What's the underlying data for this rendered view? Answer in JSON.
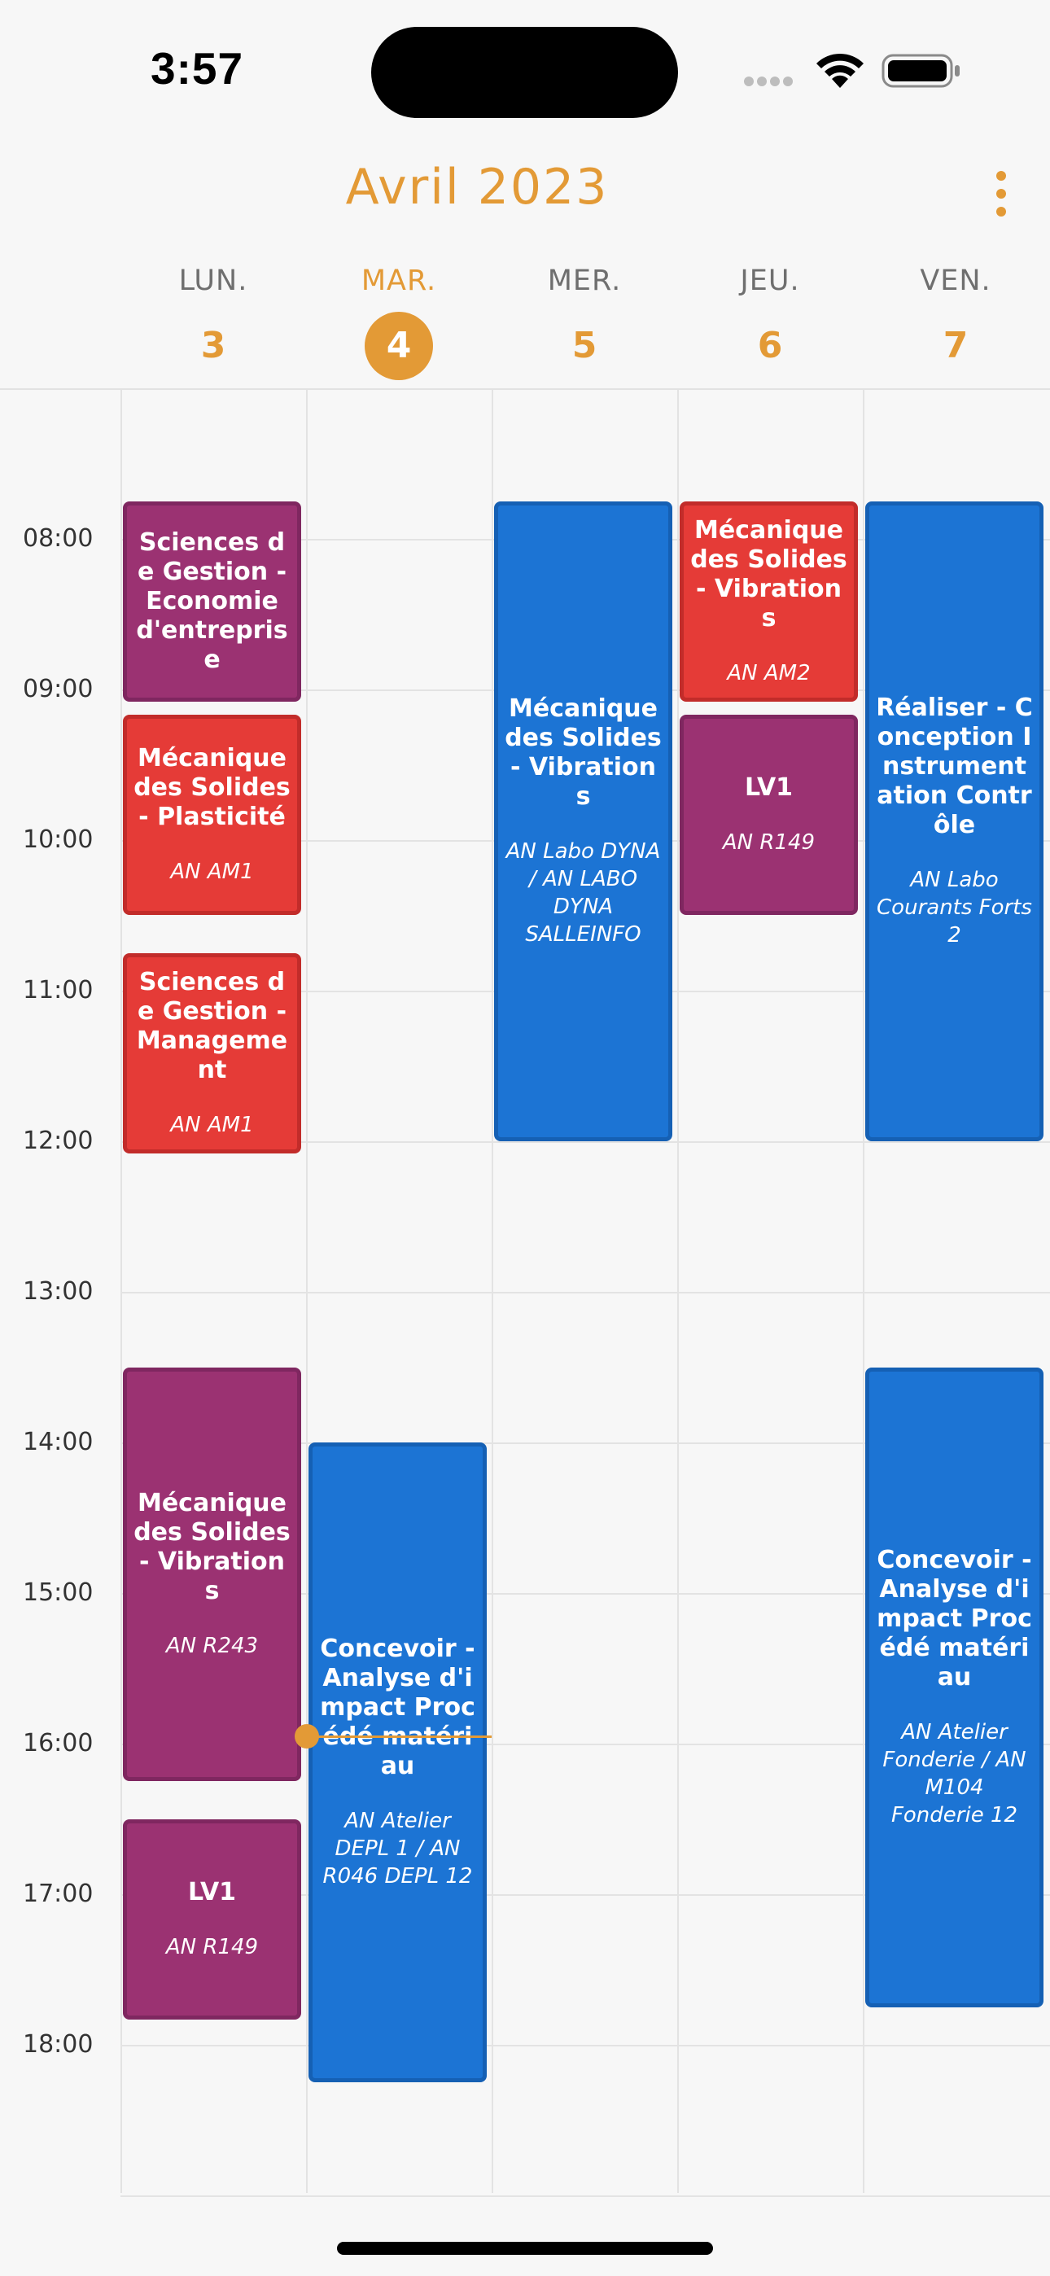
{
  "status_bar": {
    "time": "3:57"
  },
  "header": {
    "month": "Avril 2023",
    "days": [
      {
        "name": "LUN.",
        "number": "3",
        "today": false
      },
      {
        "name": "MAR.",
        "number": "4",
        "today": true
      },
      {
        "name": "MER.",
        "number": "5",
        "today": false
      },
      {
        "name": "JEU.",
        "number": "6",
        "today": false
      },
      {
        "name": "VEN.",
        "number": "7",
        "today": false
      }
    ]
  },
  "hours": [
    "08:00",
    "09:00",
    "10:00",
    "11:00",
    "12:00",
    "13:00",
    "14:00",
    "15:00",
    "16:00",
    "17:00",
    "18:00"
  ],
  "colors": {
    "accent": "#e39a36",
    "blue": "#1c74d4",
    "red": "#e53b37",
    "purple": "#9b3272"
  },
  "events": [
    {
      "day": 0,
      "start": "07:45",
      "end": "09:05",
      "color": "purple",
      "title": "Sciences de Gestion - Economie d'entreprise",
      "room": ""
    },
    {
      "day": 0,
      "start": "09:10",
      "end": "10:30",
      "color": "red",
      "title": "Mécanique des Solides - Plasticité",
      "room": "AN AM1"
    },
    {
      "day": 0,
      "start": "10:45",
      "end": "12:05",
      "color": "red",
      "title": "Sciences de Gestion - Management",
      "room": "AN AM1"
    },
    {
      "day": 0,
      "start": "13:30",
      "end": "16:15",
      "color": "purple",
      "title": "Mécanique des Solides - Vibrations",
      "room": "AN R243"
    },
    {
      "day": 0,
      "start": "16:30",
      "end": "17:50",
      "color": "purple",
      "title": "LV1",
      "room": "AN R149"
    },
    {
      "day": 1,
      "start": "14:00",
      "end": "18:15",
      "color": "blue",
      "title": "Concevoir - Analyse d'impact Procédé matériau",
      "room": "AN Atelier DEPL 1 / AN R046 DEPL 12"
    },
    {
      "day": 2,
      "start": "07:45",
      "end": "12:00",
      "color": "blue",
      "title": "Mécanique des Solides - Vibrations",
      "room": "AN Labo DYNA / AN LABO DYNA SALLEINFO"
    },
    {
      "day": 3,
      "start": "07:45",
      "end": "09:05",
      "color": "red",
      "title": "Mécanique des Solides - Vibrations",
      "room": "AN AM2"
    },
    {
      "day": 3,
      "start": "09:10",
      "end": "10:30",
      "color": "purple",
      "title": "LV1",
      "room": "AN R149"
    },
    {
      "day": 4,
      "start": "07:45",
      "end": "12:00",
      "color": "blue",
      "title": "Réaliser - Conception Instrumentation Contrôle",
      "room": "AN Labo Courants Forts 2"
    },
    {
      "day": 4,
      "start": "13:30",
      "end": "17:45",
      "color": "blue",
      "title": "Concevoir - Analyse d'impact Procédé matériau",
      "room": "AN Atelier Fonderie / AN M104 Fonderie 12"
    }
  ],
  "current_time": "15:57"
}
